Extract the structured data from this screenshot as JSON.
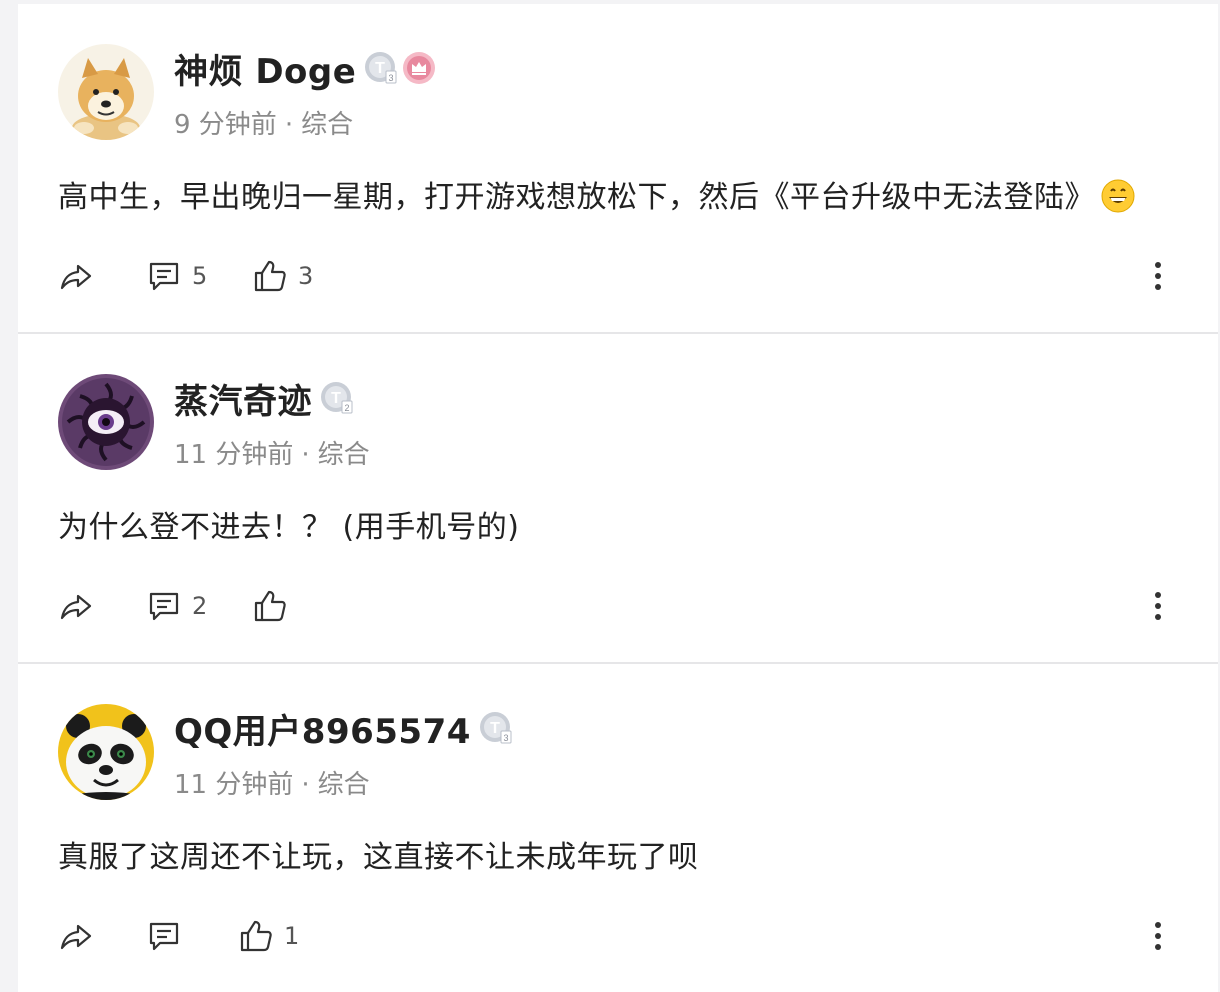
{
  "posts": [
    {
      "author": "神烦 Doge",
      "badge_level": "3",
      "has_vip_badge": true,
      "time": "9 分钟前",
      "category": "综合",
      "content": "高中生，早出晚归一星期，打开游戏想放松下，然后《平台升级中无法登陆》",
      "content_emoji": "grinning-face-emoji",
      "comments": "5",
      "likes": "3"
    },
    {
      "author": "蒸汽奇迹",
      "badge_level": "2",
      "has_vip_badge": false,
      "time": "11 分钟前",
      "category": "综合",
      "content": "为什么登不进去！？ (用手机号的)",
      "comments": "2",
      "likes": ""
    },
    {
      "author": "QQ用户8965574",
      "badge_level": "3",
      "has_vip_badge": false,
      "time": "11 分钟前",
      "category": "综合",
      "content": "真服了这周还不让玩，这直接不让未成年玩了呗",
      "comments": "",
      "likes": "1"
    }
  ],
  "meta_separator": "·",
  "icons": {
    "share": "share-icon",
    "comment": "comment-icon",
    "like": "thumbs-up-icon",
    "more": "more-vertical-icon"
  },
  "colors": {
    "text": "#222222",
    "meta": "#8a8a8a",
    "badge": "#b9bfc9",
    "vip": "#e8889e"
  }
}
